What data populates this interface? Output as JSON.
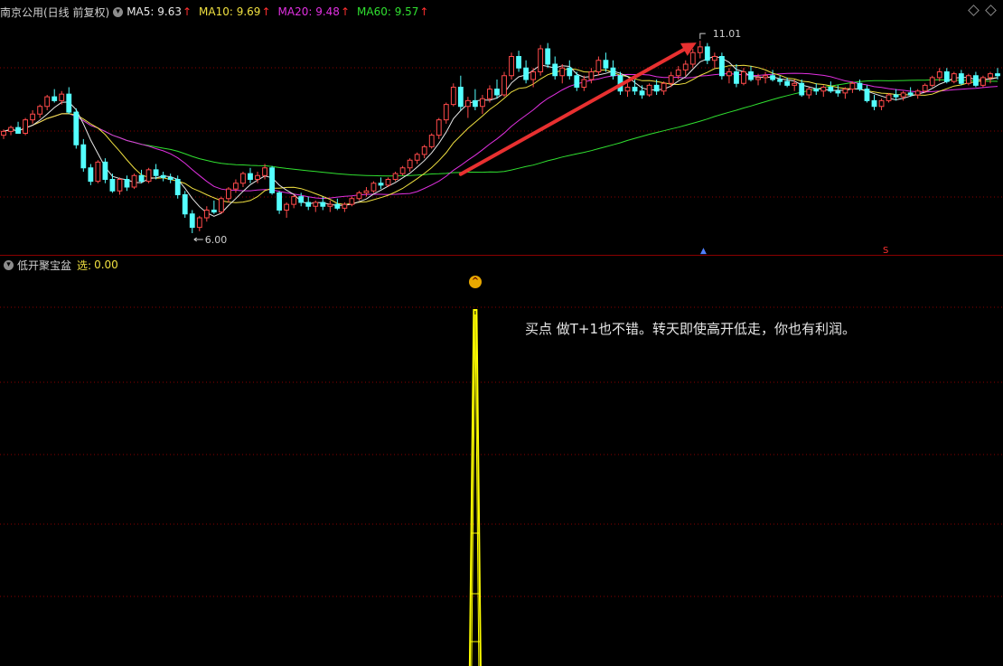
{
  "header": {
    "title": "南京公用(日线 前复权)",
    "ma": [
      {
        "label": "MA5: 9.63",
        "color": "#e8e8e8"
      },
      {
        "label": "MA10: 9.69",
        "color": "#f0e040"
      },
      {
        "label": "MA20: 9.48",
        "color": "#e030e0"
      },
      {
        "label": "MA60: 9.57",
        "color": "#30e030"
      }
    ],
    "arrow_color": "#ff3030"
  },
  "price_labels": {
    "high": "11.01",
    "low": "6.00"
  },
  "indicator": {
    "name": "低开聚宝盆",
    "select_label": "选:",
    "select_value": "0.00"
  },
  "annotation": "买点  做T+1也不错。转天即使高开低走，你也有利润。",
  "colors": {
    "up": "#ff4a4a",
    "down": "#54ffff",
    "grid": "#8a0000",
    "signal": "#ffff00",
    "trend_arrow": "#e83030"
  },
  "chart_data": {
    "type": "candlestick",
    "ylim": [
      5.6,
      11.6
    ],
    "high_label": 11.01,
    "low_label": 6.0,
    "candles": [
      [
        8.55,
        8.7,
        8.45,
        8.65
      ],
      [
        8.65,
        8.8,
        8.55,
        8.75
      ],
      [
        8.75,
        8.9,
        8.6,
        8.6
      ],
      [
        8.6,
        9.0,
        8.55,
        8.95
      ],
      [
        8.95,
        9.2,
        8.85,
        9.1
      ],
      [
        9.1,
        9.35,
        9.0,
        9.3
      ],
      [
        9.3,
        9.6,
        9.2,
        9.55
      ],
      [
        9.55,
        9.75,
        9.4,
        9.45
      ],
      [
        9.45,
        9.7,
        9.35,
        9.62
      ],
      [
        9.62,
        9.8,
        9.1,
        9.15
      ],
      [
        9.15,
        9.25,
        8.2,
        8.3
      ],
      [
        8.3,
        8.45,
        7.6,
        7.7
      ],
      [
        7.7,
        7.8,
        7.25,
        7.35
      ],
      [
        7.35,
        7.9,
        7.3,
        7.85
      ],
      [
        7.85,
        7.95,
        7.3,
        7.4
      ],
      [
        7.4,
        7.55,
        7.05,
        7.1
      ],
      [
        7.1,
        7.45,
        7.0,
        7.4
      ],
      [
        7.4,
        7.5,
        7.1,
        7.2
      ],
      [
        7.2,
        7.55,
        7.15,
        7.5
      ],
      [
        7.5,
        7.65,
        7.3,
        7.35
      ],
      [
        7.35,
        7.7,
        7.3,
        7.65
      ],
      [
        7.65,
        7.8,
        7.4,
        7.5
      ],
      [
        7.5,
        7.6,
        7.35,
        7.45
      ],
      [
        7.45,
        7.55,
        7.3,
        7.4
      ],
      [
        7.4,
        7.5,
        6.9,
        7.0
      ],
      [
        7.0,
        7.1,
        6.4,
        6.5
      ],
      [
        6.5,
        6.6,
        6.0,
        6.15
      ],
      [
        6.15,
        6.45,
        6.05,
        6.4
      ],
      [
        6.4,
        6.7,
        6.3,
        6.6
      ],
      [
        6.6,
        6.85,
        6.5,
        6.55
      ],
      [
        6.55,
        6.95,
        6.5,
        6.9
      ],
      [
        6.9,
        7.2,
        6.8,
        7.15
      ],
      [
        7.15,
        7.4,
        7.05,
        7.3
      ],
      [
        7.3,
        7.6,
        7.2,
        7.55
      ],
      [
        7.55,
        7.7,
        7.3,
        7.4
      ],
      [
        7.4,
        7.6,
        7.3,
        7.5
      ],
      [
        7.5,
        7.8,
        7.4,
        7.7
      ],
      [
        7.7,
        7.75,
        7.0,
        7.05
      ],
      [
        7.05,
        7.1,
        6.5,
        6.6
      ],
      [
        6.6,
        6.8,
        6.4,
        6.75
      ],
      [
        6.75,
        7.0,
        6.65,
        6.95
      ],
      [
        6.95,
        7.05,
        6.7,
        6.8
      ],
      [
        6.8,
        6.95,
        6.6,
        6.7
      ],
      [
        6.7,
        6.85,
        6.55,
        6.8
      ],
      [
        6.8,
        6.95,
        6.6,
        6.7
      ],
      [
        6.7,
        6.85,
        6.55,
        6.75
      ],
      [
        6.75,
        6.9,
        6.6,
        6.65
      ],
      [
        6.65,
        6.8,
        6.55,
        6.75
      ],
      [
        6.75,
        6.95,
        6.7,
        6.9
      ],
      [
        6.9,
        7.1,
        6.85,
        7.05
      ],
      [
        7.05,
        7.2,
        6.95,
        7.1
      ],
      [
        7.1,
        7.35,
        7.05,
        7.3
      ],
      [
        7.3,
        7.45,
        7.15,
        7.25
      ],
      [
        7.25,
        7.45,
        7.2,
        7.4
      ],
      [
        7.4,
        7.6,
        7.35,
        7.55
      ],
      [
        7.55,
        7.75,
        7.5,
        7.7
      ],
      [
        7.7,
        7.95,
        7.6,
        7.9
      ],
      [
        7.9,
        8.1,
        7.8,
        8.05
      ],
      [
        8.05,
        8.3,
        7.95,
        8.25
      ],
      [
        8.25,
        8.6,
        8.2,
        8.55
      ],
      [
        8.55,
        9.0,
        8.45,
        8.95
      ],
      [
        8.95,
        9.4,
        8.85,
        9.35
      ],
      [
        9.35,
        9.9,
        9.3,
        9.8
      ],
      [
        9.8,
        10.1,
        9.2,
        9.3
      ],
      [
        9.3,
        9.55,
        9.0,
        9.45
      ],
      [
        9.45,
        9.75,
        9.2,
        9.3
      ],
      [
        9.3,
        9.6,
        9.1,
        9.5
      ],
      [
        9.5,
        9.85,
        9.4,
        9.75
      ],
      [
        9.75,
        10.0,
        9.5,
        9.6
      ],
      [
        9.6,
        10.2,
        9.55,
        10.1
      ],
      [
        10.1,
        10.7,
        10.0,
        10.6
      ],
      [
        10.6,
        10.75,
        10.2,
        10.3
      ],
      [
        10.3,
        10.5,
        9.9,
        10.0
      ],
      [
        10.0,
        10.3,
        9.8,
        10.2
      ],
      [
        10.2,
        10.9,
        10.1,
        10.8
      ],
      [
        10.8,
        10.95,
        10.3,
        10.4
      ],
      [
        10.4,
        10.6,
        10.0,
        10.1
      ],
      [
        10.1,
        10.4,
        9.9,
        10.3
      ],
      [
        10.3,
        10.5,
        10.0,
        10.1
      ],
      [
        10.1,
        10.2,
        9.7,
        9.8
      ],
      [
        9.8,
        10.1,
        9.7,
        10.0
      ],
      [
        10.0,
        10.3,
        9.9,
        10.2
      ],
      [
        10.2,
        10.6,
        10.1,
        10.5
      ],
      [
        10.5,
        10.7,
        10.2,
        10.3
      ],
      [
        10.3,
        10.5,
        10.0,
        10.1
      ],
      [
        10.1,
        10.2,
        9.6,
        9.7
      ],
      [
        9.7,
        9.9,
        9.55,
        9.8
      ],
      [
        9.8,
        10.0,
        9.6,
        9.7
      ],
      [
        9.7,
        9.85,
        9.5,
        9.6
      ],
      [
        9.6,
        9.9,
        9.55,
        9.85
      ],
      [
        9.85,
        10.0,
        9.6,
        9.7
      ],
      [
        9.7,
        9.95,
        9.6,
        9.9
      ],
      [
        9.9,
        10.2,
        9.8,
        10.1
      ],
      [
        10.1,
        10.35,
        10.0,
        10.25
      ],
      [
        10.25,
        10.5,
        10.1,
        10.4
      ],
      [
        10.4,
        10.8,
        10.3,
        10.7
      ],
      [
        10.7,
        11.01,
        10.55,
        10.85
      ],
      [
        10.85,
        10.95,
        10.4,
        10.5
      ],
      [
        10.5,
        10.7,
        10.3,
        10.6
      ],
      [
        10.6,
        10.7,
        10.0,
        10.1
      ],
      [
        10.1,
        10.3,
        9.9,
        10.2
      ],
      [
        10.2,
        10.4,
        9.8,
        9.9
      ],
      [
        9.9,
        10.3,
        9.85,
        10.2
      ],
      [
        10.2,
        10.35,
        9.95,
        10.0
      ],
      [
        10.0,
        10.15,
        9.85,
        10.05
      ],
      [
        10.05,
        10.2,
        9.9,
        10.1
      ],
      [
        10.1,
        10.25,
        9.95,
        10.0
      ],
      [
        10.0,
        10.1,
        9.85,
        9.95
      ],
      [
        9.95,
        10.05,
        9.8,
        9.85
      ],
      [
        9.85,
        10.0,
        9.7,
        9.9
      ],
      [
        9.9,
        10.0,
        9.55,
        9.6
      ],
      [
        9.6,
        9.8,
        9.5,
        9.75
      ],
      [
        9.75,
        9.9,
        9.6,
        9.7
      ],
      [
        9.7,
        9.85,
        9.55,
        9.8
      ],
      [
        9.8,
        9.95,
        9.65,
        9.7
      ],
      [
        9.7,
        9.85,
        9.55,
        9.65
      ],
      [
        9.65,
        9.8,
        9.5,
        9.75
      ],
      [
        9.75,
        9.95,
        9.65,
        9.9
      ],
      [
        9.9,
        10.0,
        9.7,
        9.75
      ],
      [
        9.75,
        9.85,
        9.4,
        9.45
      ],
      [
        9.45,
        9.6,
        9.2,
        9.3
      ],
      [
        9.3,
        9.5,
        9.2,
        9.45
      ],
      [
        9.45,
        9.65,
        9.4,
        9.6
      ],
      [
        9.6,
        9.75,
        9.45,
        9.55
      ],
      [
        9.55,
        9.7,
        9.45,
        9.65
      ],
      [
        9.65,
        9.8,
        9.55,
        9.6
      ],
      [
        9.6,
        9.75,
        9.5,
        9.7
      ],
      [
        9.7,
        9.9,
        9.65,
        9.85
      ],
      [
        9.85,
        10.1,
        9.8,
        10.05
      ],
      [
        10.05,
        10.3,
        9.95,
        10.2
      ],
      [
        10.2,
        10.3,
        9.9,
        9.95
      ],
      [
        9.95,
        10.2,
        9.9,
        10.15
      ],
      [
        10.15,
        10.25,
        9.85,
        9.9
      ],
      [
        9.9,
        10.15,
        9.85,
        10.1
      ],
      [
        10.1,
        10.2,
        9.8,
        9.85
      ],
      [
        9.85,
        10.1,
        9.8,
        10.05
      ],
      [
        10.05,
        10.2,
        9.9,
        10.15
      ],
      [
        10.15,
        10.3,
        10.0,
        10.1
      ]
    ],
    "signal": {
      "candle_index": 65,
      "value_range": [
        0,
        1
      ]
    }
  }
}
